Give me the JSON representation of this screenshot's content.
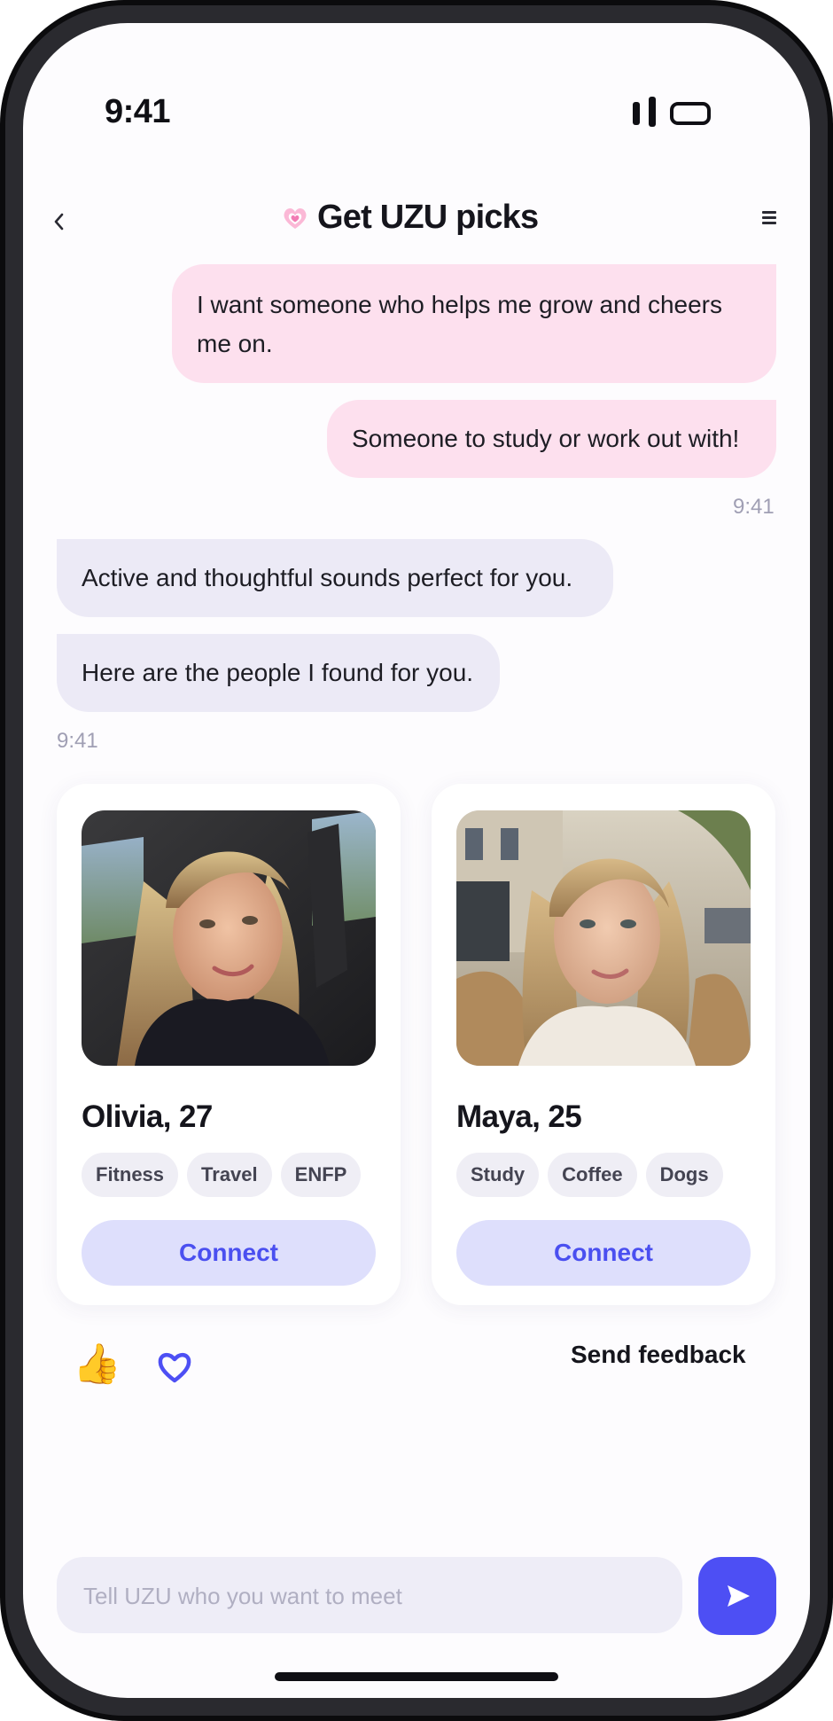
{
  "status_bar": {
    "time": "9:41"
  },
  "header": {
    "title": "Get UZU picks",
    "back_icon": "chevron-left-icon",
    "menu_icon": "menu-icon"
  },
  "messages": {
    "user": [
      "I want someone who helps me grow and cheers me on.",
      "Someone to study or work out with!"
    ],
    "user_time": "9:41",
    "bot": [
      "Active and thoughtful sounds perfect for you.",
      "Here are the people I found for you."
    ],
    "bot_time": "9:41"
  },
  "profiles": [
    {
      "name": "Olivia, 27",
      "tags": [
        "Fitness",
        "Travel",
        "ENFP"
      ],
      "connect_label": "Connect"
    },
    {
      "name": "Maya, 25",
      "tags": [
        "Study",
        "Coffee",
        "Dogs"
      ],
      "connect_label": "Connect"
    }
  ],
  "reactions": {
    "thumbs_up": "👍",
    "heart_icon": "heart-outline-icon",
    "feedback_label": "Send feedback"
  },
  "composer": {
    "placeholder": "Tell UZU who you want to meet",
    "value": ""
  },
  "colors": {
    "accent": "#4d4ff4",
    "user_bubble": "#fde0ee",
    "bot_bubble": "#eceaf6",
    "connect_bg": "#dedffc"
  }
}
